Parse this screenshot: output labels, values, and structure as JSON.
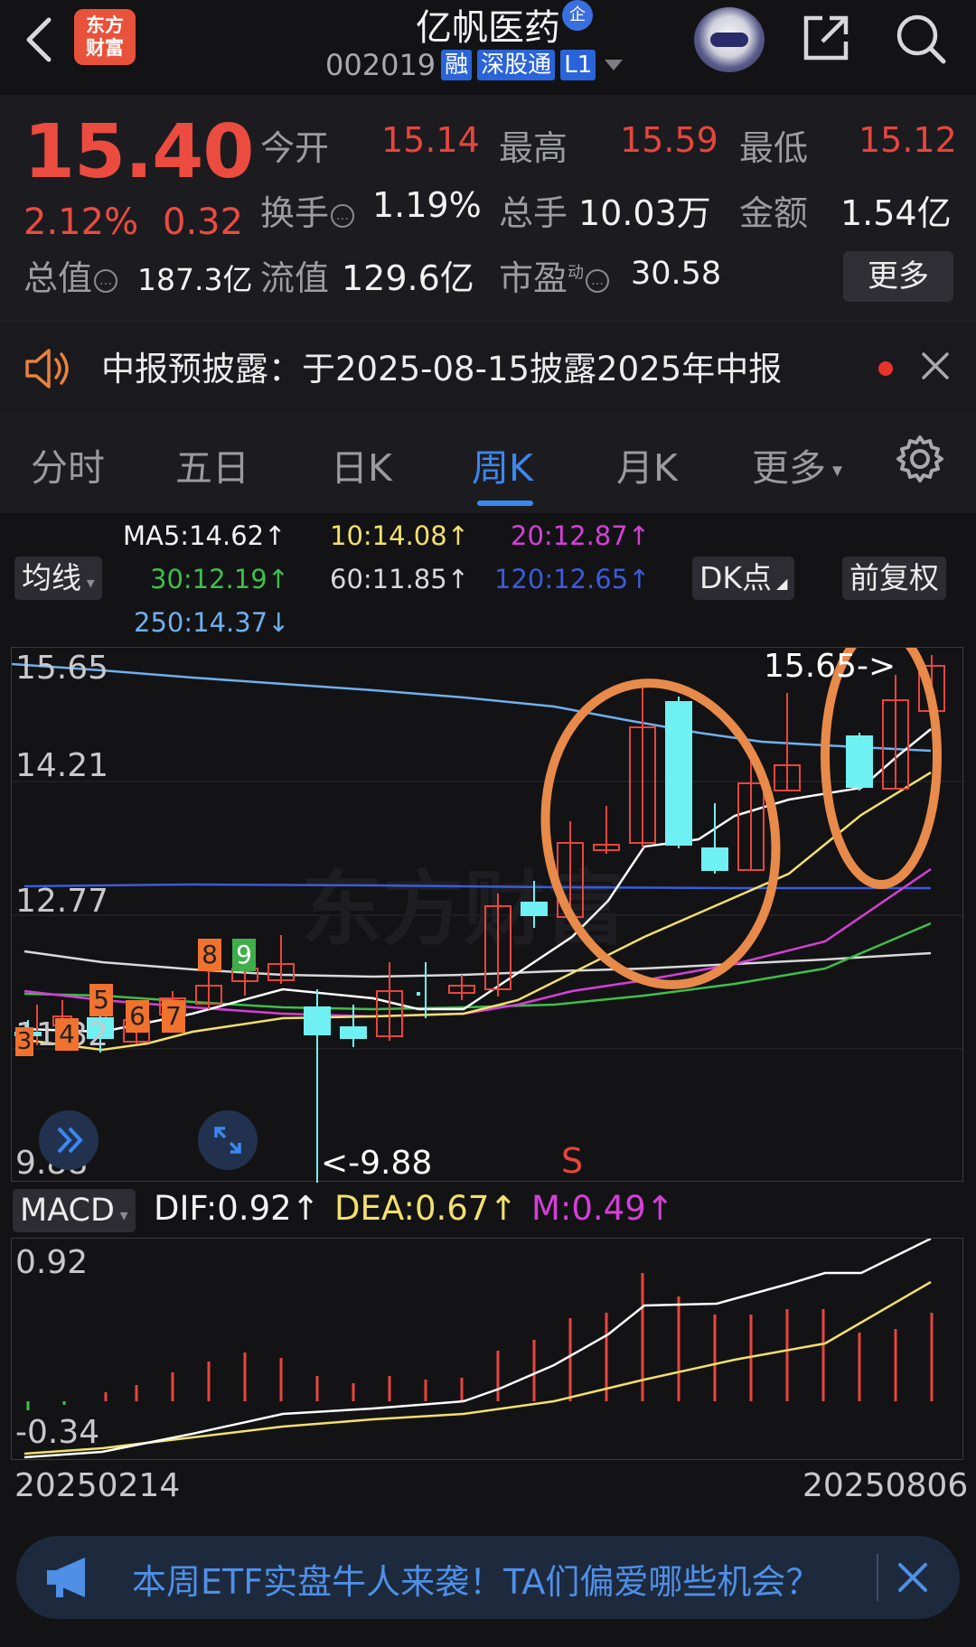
{
  "header": {
    "logo_line1": "东方",
    "logo_line2": "财富",
    "stock_name": "亿帆医药",
    "ent_badge": "企",
    "code": "002019",
    "tags": [
      "融",
      "深股通",
      "L1"
    ]
  },
  "quote": {
    "price": "15.40",
    "change_pct": "2.12%",
    "change": "0.32",
    "open_label": "今开",
    "open": "15.14",
    "high_label": "最高",
    "high": "15.59",
    "low_label": "最低",
    "low": "15.12",
    "turnover_label": "换手",
    "turnover": "1.19%",
    "volume_label": "总手",
    "volume": "10.03万",
    "amount_label": "金额",
    "amount": "1.54亿",
    "mcap_label": "总值",
    "mcap": "187.3亿",
    "float_label": "流值",
    "float_cap": "129.6亿",
    "pe_label": "市盈",
    "pe_sup": "动",
    "pe": "30.58",
    "more_label": "更多"
  },
  "notice": {
    "text": "中报预披露：于2025-08-15披露2025年中报"
  },
  "tabs": [
    "分时",
    "五日",
    "日K",
    "周K",
    "月K",
    "更多"
  ],
  "active_tab": "周K",
  "ma_legend": {
    "chip_label": "均线",
    "ma5": "MA5:14.62↑",
    "ma10": "10:14.08↑",
    "ma20": "20:12.87↑",
    "ma30": "30:12.19↑",
    "ma60": "60:11.85↑",
    "ma120": "120:12.65↑",
    "ma250": "250:14.37↓",
    "dk_label": "DK点",
    "adjust_label": "前复权"
  },
  "kline": {
    "axis_top": "15.65",
    "axis_2": "14.21",
    "axis_3": "12.77",
    "axis_4": "11.32",
    "axis_bottom": "9.88",
    "max_marker": "15.65->",
    "min_marker": "<-9.88",
    "signal_s": "S",
    "watermark": "东方财富",
    "td_numbers": [
      "3",
      "4",
      "5",
      "6",
      "7",
      "8",
      "9"
    ]
  },
  "macd": {
    "chip_label": "MACD",
    "dif": "DIF:0.92↑",
    "dea": "DEA:0.67↑",
    "m": "M:0.49↑",
    "axis_top": "0.92",
    "axis_bottom": "-0.34"
  },
  "dates": {
    "start": "20250214",
    "end": "20250806"
  },
  "ad": {
    "text": "本周ETF实盘牛人来袭！TA们偏爱哪些机会？"
  },
  "colors": {
    "up": "#e8453c",
    "down": "#6ff0f2",
    "accent": "#3b87f2",
    "ma5": "#ffffff",
    "ma10": "#f4e06b",
    "ma20": "#d63fd6",
    "ma30": "#3fbf4a",
    "ma60": "#d9d9d9",
    "ma120": "#3b5bd9",
    "ma250": "#6fb0ee",
    "highlight_circle": "#e88a4a"
  }
}
